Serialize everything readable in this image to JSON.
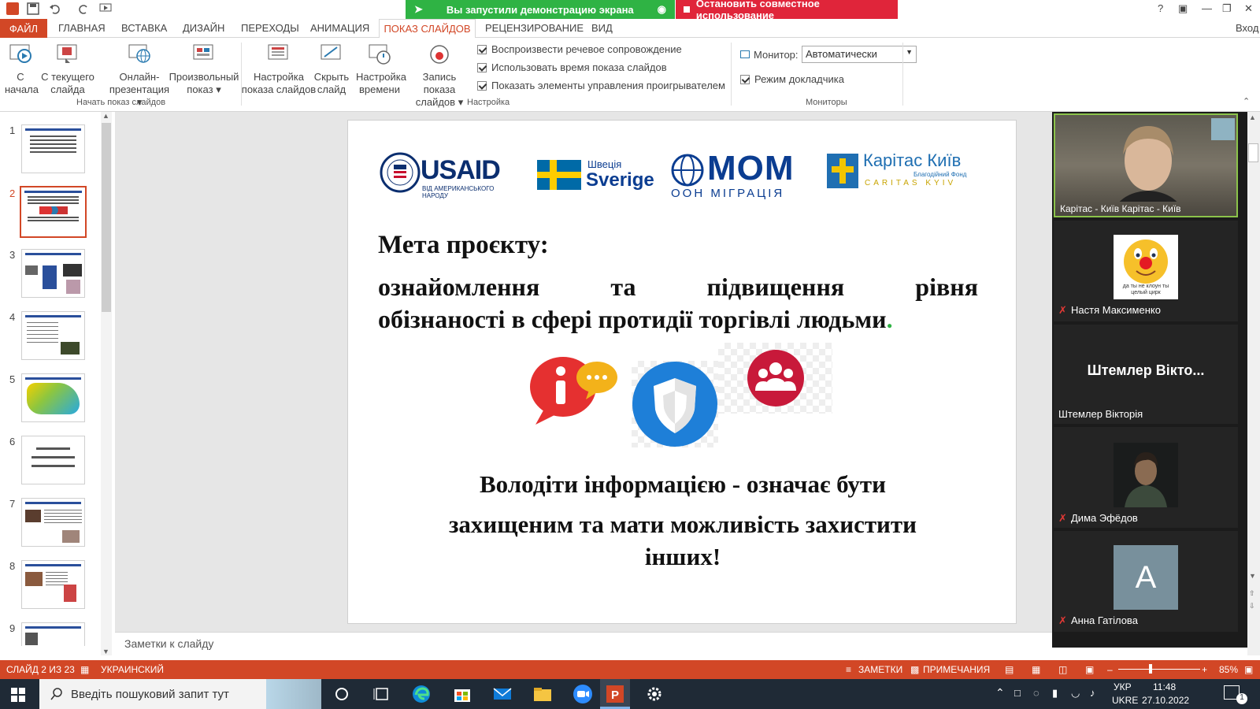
{
  "titlebar": {
    "share_notice": "Вы запустили демонстрацию экрана",
    "stop_share": "Остановить совместное использование",
    "help": "?",
    "sign_in": "Вход"
  },
  "tabs": [
    "ГЛАВНАЯ",
    "ВСТАВКА",
    "ДИЗАЙН",
    "ПЕРЕХОДЫ",
    "АНИМАЦИЯ",
    "РЕЦЕНЗИРОВАНИЕ",
    "ВИД"
  ],
  "tab_file": "ФАЙЛ",
  "tab_active": "ПОКАЗ СЛАЙДОВ",
  "ribbon": {
    "from_start_1": "С",
    "from_start_2": "начала",
    "from_current_1": "С текущего",
    "from_current_2": "слайда",
    "online_1": "Онлайн-",
    "online_2": "презентация",
    "custom_1": "Произвольный",
    "custom_2": "показ",
    "group_start": "Начать показ слайдов",
    "setup_1": "Настройка",
    "setup_2": "показа слайдов",
    "hide_1": "Скрыть",
    "hide_2": "слайд",
    "timing_1": "Настройка",
    "timing_2": "времени",
    "record_1": "Запись показа",
    "record_2": "слайдов",
    "chk_narration": "Воспроизвести речевое сопровождение",
    "chk_timings": "Использовать время показа слайдов",
    "chk_controls": "Показать элементы управления проигрывателем",
    "group_setup": "Настройка",
    "monitor_label": "Монитор:",
    "monitor_value": "Автоматически",
    "presenter_view": "Режим докладчика",
    "group_monitors": "Мониторы"
  },
  "thumbnails": [
    "1",
    "2",
    "3",
    "4",
    "5",
    "6",
    "7",
    "8",
    "9"
  ],
  "slide": {
    "logo_usaid": "USAID",
    "logo_usaid_sub": "ВІД АМЕРИКАНСЬКОГО НАРОДУ",
    "logo_sweden_1": "Швеція",
    "logo_sweden_2": "Sverige",
    "logo_mom": "МОМ",
    "logo_mom_sub": "ООН МІГРАЦІЯ",
    "logo_caritas": "Карітас Київ",
    "logo_caritas_sub1": "Благодійний Фонд",
    "logo_caritas_sub2": "CARITAS KYIV",
    "heading": "Мета проєкту:",
    "goal_line1": "ознайомлення та підвищення рівня",
    "goal_line2": "обізнаності в сфері протидії торгівлі людьми",
    "goal_dot": ".",
    "quote_line1": "Володіти інформацією - означає бути",
    "quote_line2": "захищеним та мати можливість захистити",
    "quote_line3": "інших!"
  },
  "notes_placeholder": "Заметки к слайду",
  "participants": {
    "p1": "Карітас - Київ Карітас - Київ",
    "p2_avatar_text": "да ты не клоун ты целый цирк",
    "p2": "Настя Максименко",
    "p3_big": "Штемлер Вікто...",
    "p3": "Штемлер Вікторія",
    "p4": "Дима Эфёдов",
    "p5_initial": "A",
    "p5": "Анна Гатілова"
  },
  "status": {
    "slide_count": "СЛАЙД 2 ИЗ 23",
    "language": "УКРАИНСКИЙ",
    "notes": "ЗАМЕТКИ",
    "comments": "ПРИМЕЧАНИЯ",
    "zoom": "85%"
  },
  "taskbar": {
    "search_placeholder": "Введіть пошуковий запит тут",
    "lang_1": "УКР",
    "lang_2": "UKRE",
    "time": "11:48",
    "date": "27.10.2022",
    "notif_count": "1"
  },
  "colors": {
    "accent": "#d24726",
    "share_green": "#2fb344",
    "share_red": "#e0253a",
    "usaid_blue": "#0b2e6f",
    "usaid_red": "#c8102e",
    "mom_blue": "#0b3d91",
    "caritas_blue": "#1f6fb2"
  }
}
